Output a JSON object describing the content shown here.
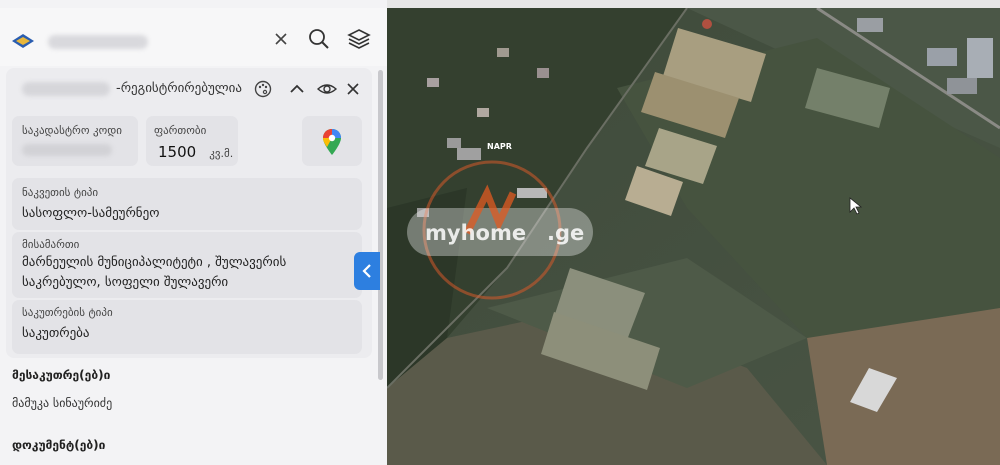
{
  "header": {
    "icons": [
      "close-icon",
      "search-icon",
      "layers-icon"
    ]
  },
  "parcel": {
    "status": "-რეგისტრირებულია",
    "cadastral_label": "საკადასტრო კოდი",
    "area_label": "ფართობი",
    "area_value": "1500",
    "area_unit": "კვ.მ.",
    "land_type_label": "ნაკვეთის ტიპი",
    "land_type_value": "სასოფლო-სამეურნეო",
    "address_label": "მისამართი",
    "address_line1": "მარნეულის მუნიციპალიტეტი , შულავერის",
    "address_line2": "საკრებულო, სოფელი შულავერი",
    "ownership_label": "საკუთრების ტიპი",
    "ownership_value": "საკუთრება"
  },
  "owners": {
    "title": "მესაკუთრე(ებ)ი",
    "name": "მამუკა სინაურიძე"
  },
  "documents": {
    "title": "დოკუმენტ(ებ)ი"
  },
  "map": {
    "label": "NAPR",
    "watermark_brand": "myhome",
    "watermark_tld": ".ge"
  },
  "colors": {
    "accent": "#2d7fe0"
  }
}
